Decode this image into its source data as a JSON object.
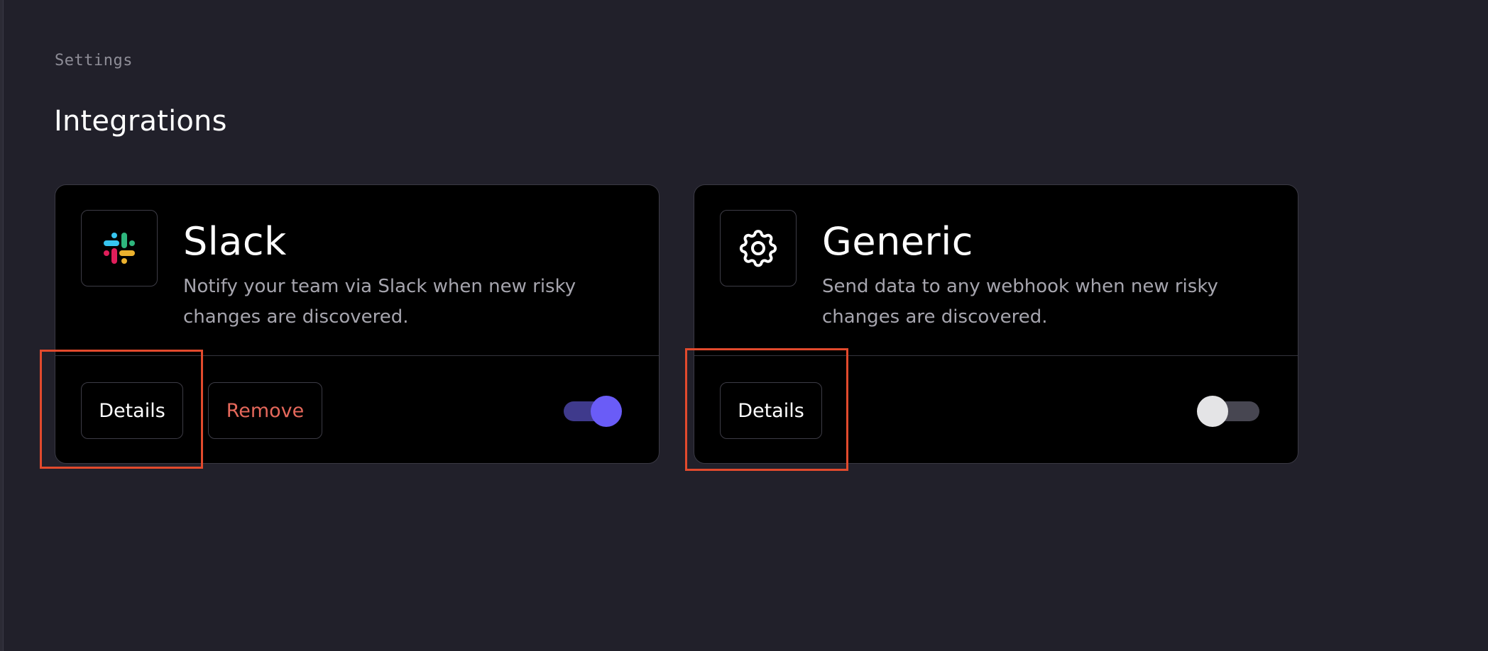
{
  "breadcrumb": "Settings",
  "page_title": "Integrations",
  "integrations": [
    {
      "name": "Slack",
      "description": "Notify your team via Slack when new risky changes are discovered.",
      "icon": "slack-logo-icon",
      "details_label": "Details",
      "remove_label": "Remove",
      "enabled": true
    },
    {
      "name": "Generic",
      "description": "Send data to any webhook when new risky changes are discovered.",
      "icon": "gear-icon",
      "details_label": "Details",
      "enabled": false
    }
  ],
  "colors": {
    "background": "#21202a",
    "card": "#000000",
    "accent": "#6a5cf7",
    "danger": "#e5685b",
    "highlight": "#e24a2d"
  }
}
